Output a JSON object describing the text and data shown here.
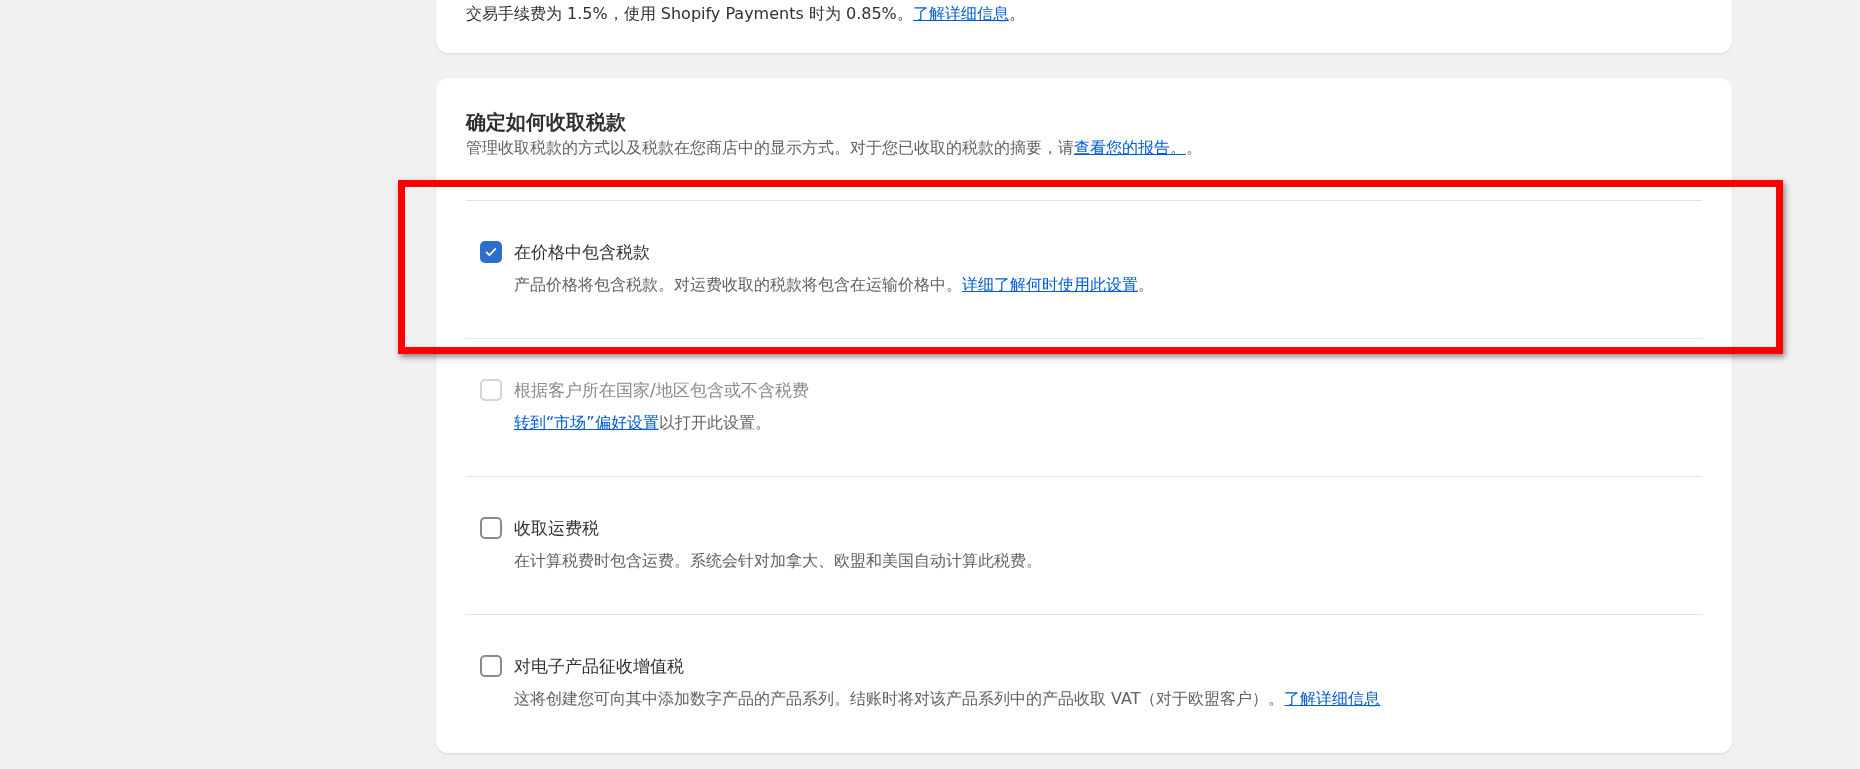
{
  "fee_card": {
    "text": "交易手续费为 1.5%，使用 Shopify Payments 时为 0.85%。",
    "link": "了解详细信息",
    "after": "。"
  },
  "tax_card": {
    "title": "确定如何收取税款",
    "description": {
      "text": "管理收取税款的方式以及税款在您商店中的显示方式。对于您已收取的税款的摘要，请",
      "link": "查看您的报告。",
      "after": "。"
    },
    "options": [
      {
        "label": "在价格中包含税款",
        "checked": true,
        "disabled": false,
        "highlighted": true,
        "description": {
          "text": "产品价格将包含税款。对运费收取的税款将包含在运输价格中。",
          "link": "详细了解何时使用此设置",
          "after": "。"
        }
      },
      {
        "label": "根据客户所在国家/地区包含或不含税费",
        "checked": false,
        "disabled": true,
        "highlighted": false,
        "description": {
          "link": "转到“市场”偏好设置",
          "after": "以打开此设置。"
        }
      },
      {
        "label": "收取运费税",
        "checked": false,
        "disabled": false,
        "highlighted": false,
        "description": {
          "text": "在计算税费时包含运费。系统会针对加拿大、欧盟和美国自动计算此税费。"
        }
      },
      {
        "label": "对电子产品征收增值税",
        "checked": false,
        "disabled": false,
        "highlighted": false,
        "description": {
          "text": "这将创建您可向其中添加数字产品的产品系列。结账时将对该产品系列中的产品收取 VAT（对于欧盟客户）。",
          "link": "了解详细信息"
        }
      }
    ]
  }
}
